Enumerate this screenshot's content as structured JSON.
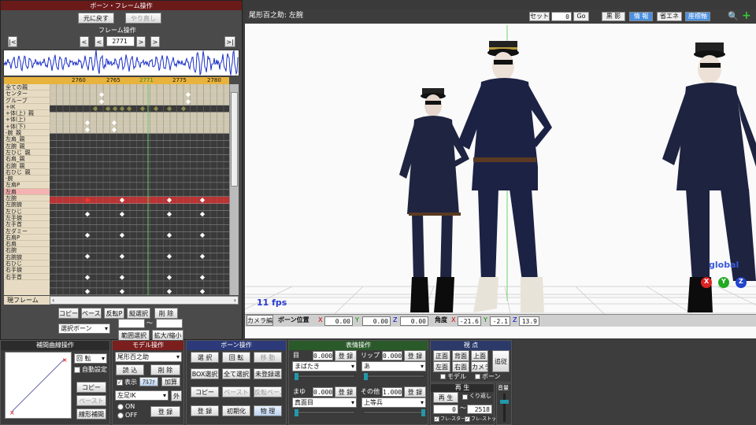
{
  "frame_panel": {
    "title": "ボーン・フレーム操作",
    "undo": "元に戻す",
    "redo": "やり直し",
    "frame_op_label": "フレーム操作",
    "frame_value": "2771",
    "nav_first": "|<",
    "nav_prev": "<",
    "nav_prev_small": "<",
    "nav_next_small": ">",
    "nav_next": ">",
    "nav_last": ">|",
    "ruler_ticks": [
      "2760",
      "2765",
      "2771",
      "2775",
      "2780"
    ],
    "current_marker": "2771",
    "tracks": [
      "全ての親",
      "センター",
      "グルーブ",
      "+IK",
      "+体(上)_親",
      "+体(上)",
      "+体(下)",
      "-腕_親",
      "左肩_親",
      "左腕_親",
      "左ひじ_親",
      "右肩_親",
      "右腕_親",
      "右ひじ_親",
      "-腕",
      "左肩P",
      "左肩",
      "左腕",
      "左腕捩",
      "左ひじ",
      "左手捩",
      "左手首",
      "左ダミー",
      "右肩P",
      "右肩",
      "右腕",
      "右腕捩",
      "右ひじ",
      "右手捩",
      "右手首"
    ],
    "current_frame_label": "現フレーム",
    "copy": "コピー",
    "paste": "ペースト",
    "reverse_paste": "反転P",
    "vertical_select": "縦選択",
    "delete": "削 除",
    "select_bone": "選択ボーン",
    "range_select": "範囲選択",
    "expand_shrink": "拡大/縮小",
    "range_tilde": "〜"
  },
  "viewport": {
    "title": "尾形百之助: 左腕",
    "set_label": "セット",
    "frame_input": "0",
    "go": "Go",
    "shadow": "黒 影",
    "info": "情 報",
    "energy_save": "省エネ",
    "coordinate_axis": "座標軸",
    "fps": "11 fps",
    "global_label": "global",
    "axis_x": "X",
    "axis_y": "Y",
    "axis_z": "Z"
  },
  "bone_position_bar": {
    "camera_edit": "カメラ編",
    "bone_position": "ボーン位置",
    "x": "0.00",
    "y": "0.00",
    "z": "0.00",
    "angle_label": "角度",
    "ax": "-21.6",
    "ay": "-2.1",
    "az": "13.9",
    "lx": "X",
    "ly": "Y",
    "lz": "Z"
  },
  "interp_panel": {
    "title": "補間曲線操作",
    "rotation": "回 転",
    "auto_set": "自動設定",
    "copy": "コピー",
    "paste": "ペースト",
    "linear": "線形補間"
  },
  "model_panel": {
    "title": "モデル操作",
    "model_name": "尾形百之助",
    "load": "読 込",
    "delete": "削 除",
    "display": "表示",
    "alpha": "ｱﾙﾌｧ",
    "add_light": "加算",
    "foot_ik": "左足IK",
    "outside": "外",
    "on": "ON",
    "off": "OFF",
    "register": "登 録"
  },
  "bone_panel": {
    "title": "ボーン操作",
    "select": "選 択",
    "rotate": "回 転",
    "move": "移 動",
    "box_select": "BOX選択",
    "select_all": "全て選択",
    "unregistered_select": "未登録選",
    "copy": "コピー",
    "paste": "ペースト",
    "reverse_paste": "反転ペースト",
    "register": "登 録",
    "reset": "初期化",
    "physics": "物 理"
  },
  "morph_panel": {
    "title": "表情操作",
    "eye_label": "目",
    "eye_value": "0.000",
    "eye_morph": "まばたき",
    "lip_label": "リップ",
    "lip_value": "0.000",
    "lip_morph": "あ",
    "brow_label": "まゆ",
    "brow_value": "0.000",
    "brow_morph": "真面目",
    "other_label": "その他",
    "other_value": "1.000",
    "other_morph": "上等兵",
    "register": "登 録"
  },
  "view_panel": {
    "title": "視 点",
    "front": "正面",
    "back": "背面",
    "top": "上面",
    "follow": "追従",
    "left": "左面",
    "right": "右面",
    "camera": "カメラ",
    "model": "モデル",
    "bone": "ボーン"
  },
  "playback_panel": {
    "title": "再 生",
    "play": "再 生",
    "repeat": "くり返し",
    "from": "0",
    "to": "2518",
    "tilde": "〜",
    "frame_start": "フレ-スタート",
    "frame_stop": "フレ-ストップ",
    "volume": "音量"
  }
}
